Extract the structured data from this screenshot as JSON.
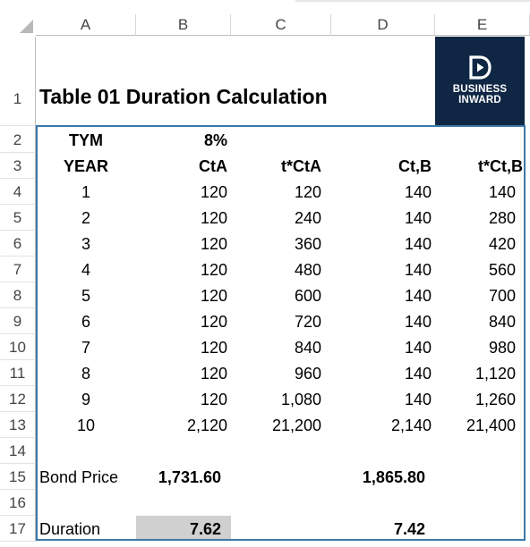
{
  "columns": [
    "A",
    "B",
    "C",
    "D",
    "E"
  ],
  "rows": [
    "1",
    "2",
    "3",
    "4",
    "5",
    "6",
    "7",
    "8",
    "9",
    "10",
    "11",
    "12",
    "13",
    "14",
    "15",
    "16",
    "17"
  ],
  "title": "Table 01   Duration Calculation",
  "logo": {
    "line1": "BUSINESS",
    "line2": "INWARD",
    "bg": "#0f2744"
  },
  "rate_row": {
    "label": "TYM",
    "value": "8%"
  },
  "headers": {
    "year": "YEAR",
    "cta": "CtA",
    "tcta": "t*CtA",
    "ctb": "Ct,B",
    "tctb": "t*Ct,B"
  },
  "table": [
    {
      "year": "1",
      "cta": "120",
      "tcta": "120",
      "ctb": "140",
      "tctb": "140"
    },
    {
      "year": "2",
      "cta": "120",
      "tcta": "240",
      "ctb": "140",
      "tctb": "280"
    },
    {
      "year": "3",
      "cta": "120",
      "tcta": "360",
      "ctb": "140",
      "tctb": "420"
    },
    {
      "year": "4",
      "cta": "120",
      "tcta": "480",
      "ctb": "140",
      "tctb": "560"
    },
    {
      "year": "5",
      "cta": "120",
      "tcta": "600",
      "ctb": "140",
      "tctb": "700"
    },
    {
      "year": "6",
      "cta": "120",
      "tcta": "720",
      "ctb": "140",
      "tctb": "840"
    },
    {
      "year": "7",
      "cta": "120",
      "tcta": "840",
      "ctb": "140",
      "tctb": "980"
    },
    {
      "year": "8",
      "cta": "120",
      "tcta": "960",
      "ctb": "140",
      "tctb": "1,120"
    },
    {
      "year": "9",
      "cta": "120",
      "tcta": "1,080",
      "ctb": "140",
      "tctb": "1,260"
    },
    {
      "year": "10",
      "cta": "2,120",
      "tcta": "21,200",
      "ctb": "2,140",
      "tctb": "21,400"
    }
  ],
  "bond_price": {
    "label": "Bond Price",
    "a": "1,731.60",
    "b": "1,865.80"
  },
  "duration": {
    "label": "Duration",
    "a": "7.62",
    "b": "7.42"
  },
  "colors": {
    "accent_border": "#3b78a8",
    "selected_cell": "#d0d0d0"
  }
}
